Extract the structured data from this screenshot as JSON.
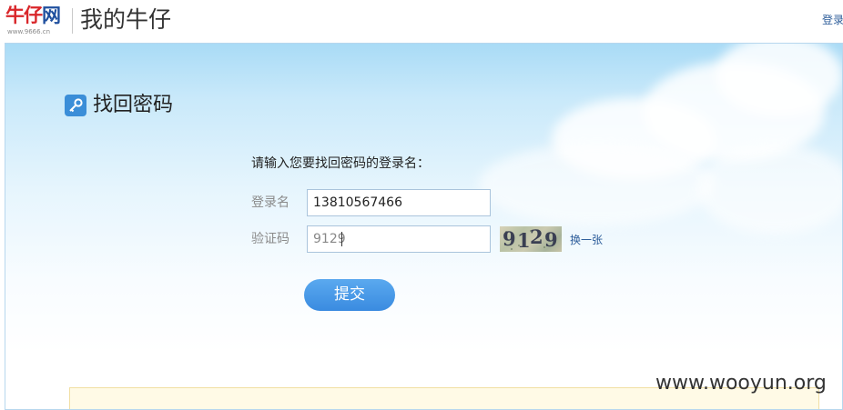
{
  "header": {
    "logo_part1": "牛仔",
    "logo_part2": "网",
    "logo_url": "www.9666.cn",
    "site_title": "我的牛仔",
    "login_label": "登录"
  },
  "main": {
    "section_title": "找回密码",
    "instruction": "请输入您要找回密码的登录名：",
    "username_label": "登录名",
    "username_value": "13810567466",
    "captcha_label": "验证码",
    "captcha_value": "9129",
    "captcha_image_text": [
      "9",
      "1",
      "2",
      "9"
    ],
    "refresh_label": "换一张",
    "submit_label": "提交"
  },
  "watermark": "www.wooyun.org",
  "colors": {
    "accent": "#3a8be0",
    "link": "#2d5d9a",
    "logo_red": "#d9262a",
    "logo_blue": "#1f4f9e"
  },
  "icons": {
    "section_icon": "key-icon"
  }
}
